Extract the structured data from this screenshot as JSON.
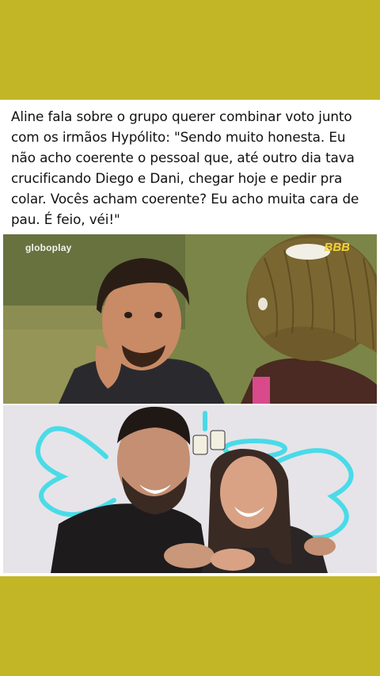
{
  "post": {
    "caption": "Aline fala sobre o grupo querer combinar voto junto com os irmãos Hypólito: \"Sendo muito honesta. Eu não acho coerente o pessoal que, até outro dia tava crucificando Diego e Dani, chegar hoje e pedir pra colar. Vocês acham coerente? Eu acho muita cara de pau. É feio, véi!\""
  },
  "images": {
    "top": {
      "watermark_left": "globoplay",
      "watermark_right": "BBB"
    },
    "bottom": {}
  },
  "colors": {
    "page_background": "#c2b526",
    "card_background": "#ffffff",
    "neon_wings": "#39d9e8"
  }
}
